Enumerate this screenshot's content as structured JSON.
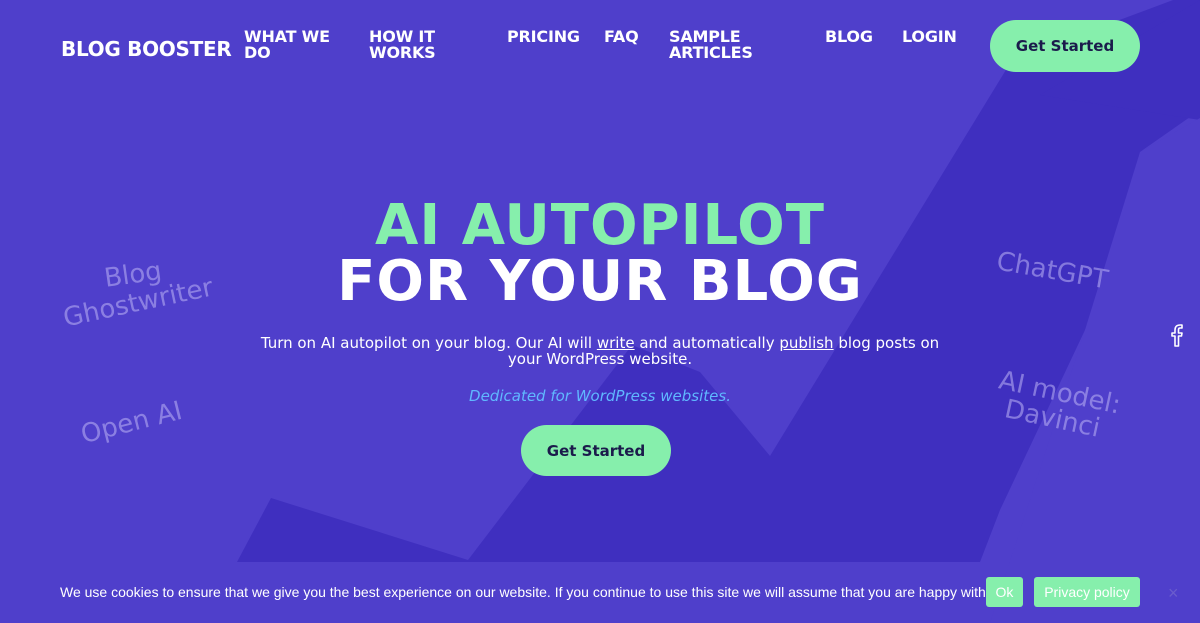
{
  "nav": {
    "logo": "BLOG BOOSTER",
    "links": [
      {
        "line1": "WHAT WE",
        "line2": "DO"
      },
      {
        "line1": "HOW IT",
        "line2": "WORKS"
      },
      {
        "line1": "PRICING",
        "line2": ""
      },
      {
        "line1": "FAQ",
        "line2": ""
      },
      {
        "line1": "SAMPLE",
        "line2": "ARTICLES"
      },
      {
        "line1": "BLOG",
        "line2": ""
      },
      {
        "line1": "LOGIN",
        "line2": ""
      }
    ],
    "cta": "Get Started"
  },
  "hero": {
    "title_line1": "AI AUTOPILOT",
    "title_line2": "FOR YOUR BLOG",
    "subtitle": {
      "part1": "Turn on AI autopilot on your blog. Our AI will ",
      "link1": "write",
      "part2": " and automatically ",
      "link2": "publish",
      "part3": " blog posts on your WordPress website."
    },
    "dedicated": "Dedicated for WordPress websites.",
    "cta": "Get Started"
  },
  "tags": {
    "left_top_line1": "Blog",
    "left_top_line2": "Ghostwriter",
    "left_bottom": "Open AI",
    "right_top": "ChatGPT",
    "right_bottom_line1": "AI model:",
    "right_bottom_line2": "Davinci"
  },
  "social": {
    "facebook_icon": "facebook-icon"
  },
  "cookie": {
    "text": "We use cookies to ensure that we give you the best experience on our website. If you continue to use this site we will assume that you are happy with it.",
    "ok": "Ok",
    "privacy": "Privacy policy",
    "close": "×"
  },
  "colors": {
    "background": "#4f3fcb",
    "arrow": "#3f2fbf",
    "accent": "#86efac",
    "link_blue": "#60b8ff"
  }
}
